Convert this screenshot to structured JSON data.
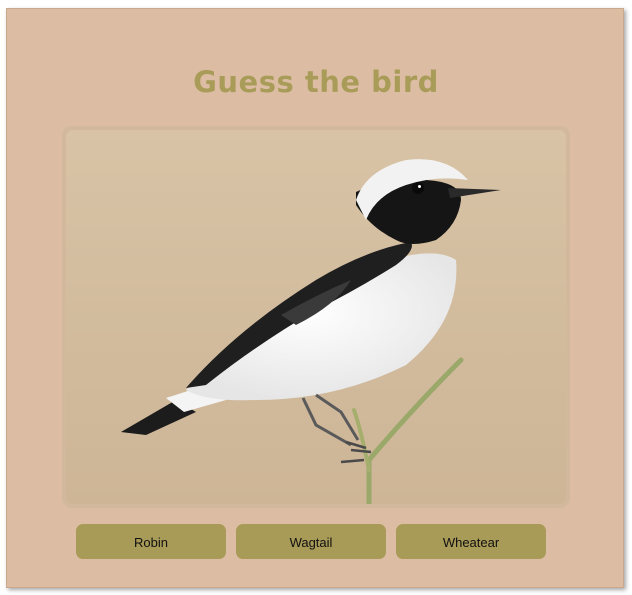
{
  "game": {
    "title": "Guess the bird",
    "image_subject": "bird-photo",
    "options": [
      "Robin",
      "Wagtail",
      "Wheatear"
    ]
  },
  "colors": {
    "background": "#dcbda4",
    "title": "#a99c58",
    "button": "#a89a57"
  }
}
